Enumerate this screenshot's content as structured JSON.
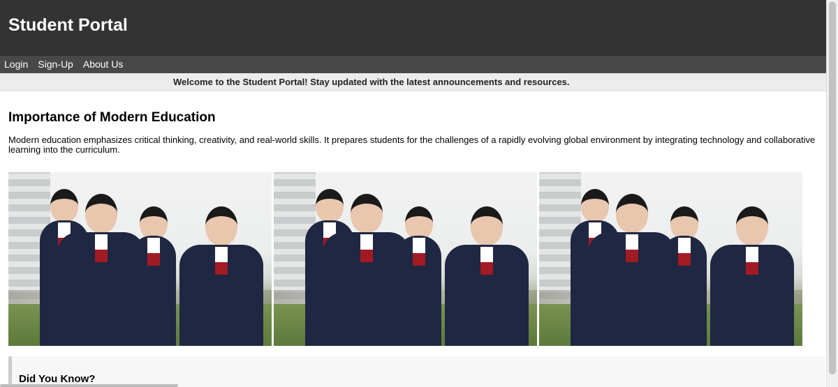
{
  "header": {
    "title": "Student Portal"
  },
  "nav": {
    "items": [
      {
        "label": "Login"
      },
      {
        "label": "Sign-Up"
      },
      {
        "label": "About Us"
      }
    ]
  },
  "welcome": {
    "message": "Welcome to the Student Portal! Stay updated with the latest announcements and resources."
  },
  "main": {
    "heading": "Importance of Modern Education",
    "paragraph": "Modern education emphasizes critical thinking, creativity, and real-world skills. It prepares students for the challenges of a rapidly evolving global environment by integrating technology and collaborative learning into the curriculum."
  },
  "gallery": {
    "images": [
      {
        "label": "students-photo"
      },
      {
        "label": "students-photo"
      },
      {
        "label": "students-photo"
      }
    ]
  },
  "did_you_know": {
    "heading": "Did You Know?"
  },
  "colors": {
    "header_bg": "#333333",
    "nav_bg": "#484848",
    "welcome_bg": "#ececec",
    "uniform": "#1f2742"
  }
}
